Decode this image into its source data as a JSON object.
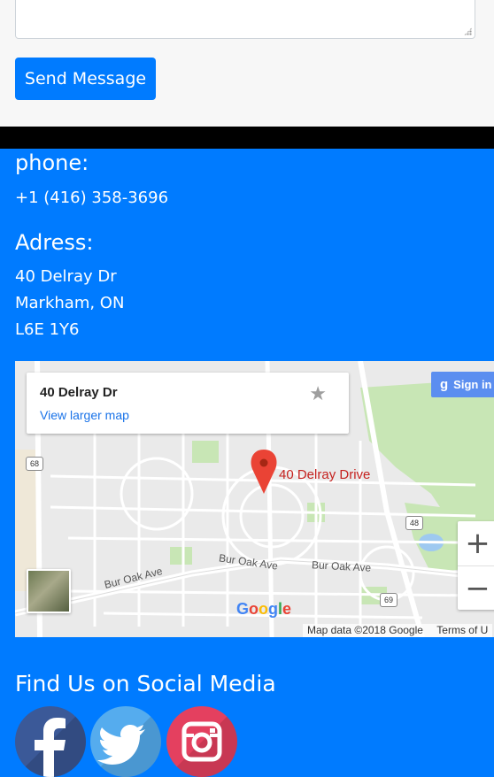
{
  "form": {
    "send_label": "Send Message"
  },
  "contact": {
    "phone_heading": "phone:",
    "phone_value": "+1 (416) 358-3696",
    "address_heading": "Adress:",
    "address_lines": [
      "40 Delray Dr",
      "Markham, ON",
      "L6E 1Y6"
    ]
  },
  "map": {
    "place_name": "40 Delray Dr",
    "view_larger": "View larger map",
    "sign_in": "Sign in",
    "pin_label": "40 Delray Drive",
    "google_logo": "Google",
    "attribution": "Map data ©2018 Google",
    "terms": "Terms of U",
    "roads": [
      "Bur Oak Ave",
      "Bur Oak Ave",
      "Bur Oak Ave"
    ],
    "route_shields": [
      "68",
      "48",
      "69"
    ],
    "zoom_in": "+",
    "zoom_out": "−",
    "star_glyph": "★"
  },
  "social": {
    "heading": "Find Us on Social Media",
    "icons": [
      {
        "name": "facebook-icon",
        "color": "#3b5998"
      },
      {
        "name": "twitter-icon",
        "color": "#55acee"
      },
      {
        "name": "instagram-icon",
        "color": "#e4405f"
      }
    ]
  },
  "colors": {
    "accent": "#007bff",
    "form_bg": "#f7f7f7",
    "divider": "#000000"
  }
}
